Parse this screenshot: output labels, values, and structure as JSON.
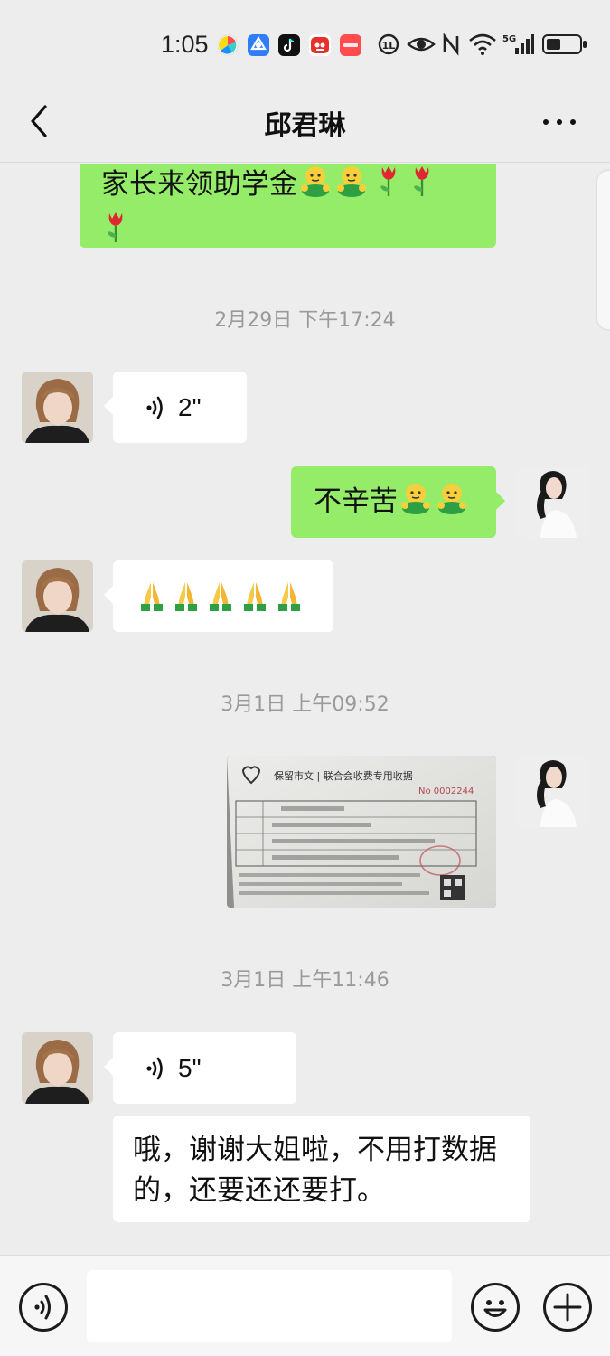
{
  "status_bar": {
    "time": "1:05",
    "network_label": "5G",
    "battery_level": 0.45,
    "app_icons": [
      "pinwheel-app-icon",
      "blue-app-icon",
      "tiktok-icon",
      "red-dog-app-icon",
      "huawei-app-icon"
    ],
    "system_icons": [
      "nfc-icon",
      "eye-comfort-icon",
      "n-icon",
      "wifi-icon",
      "signal-icon",
      "battery-icon"
    ]
  },
  "nav": {
    "title": "邱君琳"
  },
  "messages": [
    {
      "side": "right",
      "type": "text",
      "text": "家长来领助学金",
      "emojis": [
        "hug",
        "hug",
        "tulip",
        "tulip",
        "tulip"
      ]
    },
    {
      "type": "timestamp",
      "text": "2月29日 下午17:24"
    },
    {
      "side": "left",
      "type": "voice",
      "duration": "2\""
    },
    {
      "side": "right",
      "type": "text",
      "text": "不辛苦",
      "emojis": [
        "hug",
        "hug"
      ]
    },
    {
      "side": "left",
      "type": "emoji",
      "emojis": [
        "pray",
        "pray",
        "pray",
        "pray",
        "pray"
      ]
    },
    {
      "type": "timestamp",
      "text": "3月1日 上午09:52"
    },
    {
      "side": "right",
      "type": "image",
      "receipt": {
        "org": "保留市文 | 联合会收费专用收据",
        "number": "No 0002244"
      }
    },
    {
      "type": "timestamp",
      "text": "3月1日 上午11:46"
    },
    {
      "side": "left",
      "type": "voice",
      "duration": "5\""
    },
    {
      "side": "left",
      "type": "text",
      "text": "哦，谢谢大姐啦，不用打数据的，还要还还要打。",
      "lines": [
        "哦，谢谢大姐啦，不用打数据",
        "的，还要还还要打。"
      ]
    }
  ],
  "colors": {
    "background": "#ededed",
    "green_bubble": "#95ec69",
    "white_bubble": "#ffffff",
    "timestamp": "#9a9a9a"
  },
  "input": {
    "placeholder": "",
    "value": ""
  }
}
